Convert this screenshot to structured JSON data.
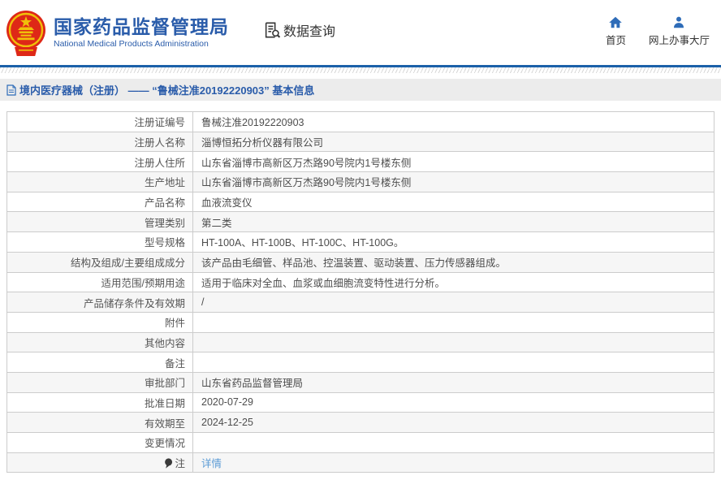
{
  "header": {
    "agency_name_zh": "国家药品监督管理局",
    "agency_name_en": "National Medical Products Administration",
    "nav_data_query": "数据查询",
    "nav_home": "首页",
    "nav_service_hall": "网上办事大厅"
  },
  "breadcrumb": {
    "title": "境内医疗器械（注册） —— “鲁械注准20192220903” 基本信息"
  },
  "table": {
    "rows": [
      {
        "label": "注册证编号",
        "value": "鲁械注准20192220903"
      },
      {
        "label": "注册人名称",
        "value": "淄博恒拓分析仪器有限公司"
      },
      {
        "label": "注册人住所",
        "value": "山东省淄博市高新区万杰路90号院内1号楼东侧"
      },
      {
        "label": "生产地址",
        "value": "山东省淄博市高新区万杰路90号院内1号楼东侧"
      },
      {
        "label": "产品名称",
        "value": "血液流变仪"
      },
      {
        "label": "管理类别",
        "value": "第二类"
      },
      {
        "label": "型号规格",
        "value": "HT-100A、HT-100B、HT-100C、HT-100G。"
      },
      {
        "label": "结构及组成/主要组成成分",
        "value": "该产品由毛细管、样品池、控温装置、驱动装置、压力传感器组成。"
      },
      {
        "label": "适用范围/预期用途",
        "value": "适用于临床对全血、血浆或血细胞流变特性进行分析。"
      },
      {
        "label": "产品储存条件及有效期",
        "value": "/"
      },
      {
        "label": "附件",
        "value": ""
      },
      {
        "label": "其他内容",
        "value": ""
      },
      {
        "label": "备注",
        "value": ""
      },
      {
        "label": "审批部门",
        "value": "山东省药品监督管理局"
      },
      {
        "label": "批准日期",
        "value": "2020-07-29"
      },
      {
        "label": "有效期至",
        "value": "2024-12-25"
      },
      {
        "label": "变更情况",
        "value": ""
      },
      {
        "label": "注",
        "value": "详情",
        "link": true,
        "icon": "pin-icon"
      }
    ]
  },
  "icons": {
    "emblem": "national-emblem",
    "data_query": "document-search-icon",
    "home": "home-icon",
    "service_hall": "person-icon",
    "breadcrumb": "document-icon",
    "note": "pin-icon"
  },
  "colors": {
    "brand_blue": "#2a5caa",
    "nav_icon_blue": "#2e6cb8",
    "rule_blue": "#1b61a9",
    "title_bar_bg": "#ececec",
    "alt_row_bg": "#f6f6f6",
    "border": "#cccccc",
    "text": "#4d4d4d",
    "link_blue": "#5b9bd5",
    "emblem_red": "#de2817",
    "emblem_gold": "#f0c00a"
  }
}
